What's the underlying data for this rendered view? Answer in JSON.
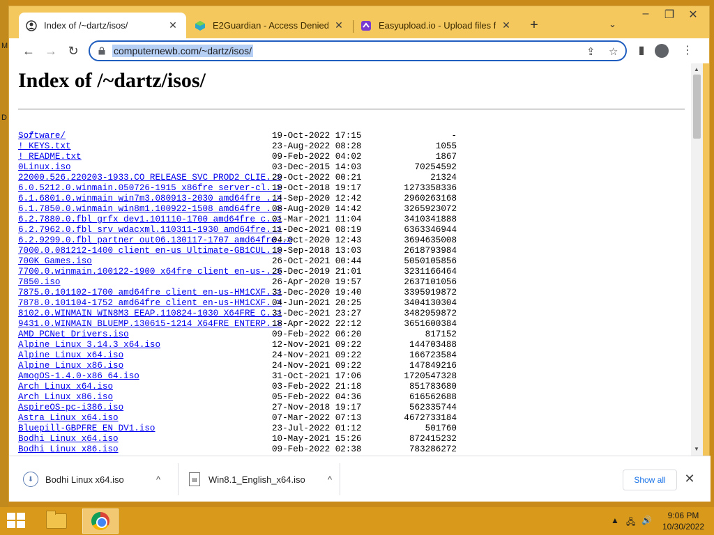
{
  "desktop": {
    "edge_letters": [
      "M",
      "D"
    ]
  },
  "browser": {
    "tabs": [
      {
        "title": "Index of /~dartz/isos/",
        "favicon": "globe-person-icon",
        "active": true
      },
      {
        "title": "E2Guardian - Access Denied",
        "favicon": "e2guardian-icon",
        "active": false
      },
      {
        "title": "Easyupload.io - Upload files for f",
        "favicon": "easyupload-icon",
        "active": false
      }
    ],
    "url": "computernewb.com/~dartz/isos/",
    "colors": {
      "tabstrip": "#f4c85d",
      "url_highlight": "#b6cff5",
      "link": "#0000ee",
      "omnibox_border": "#1f5dbf"
    }
  },
  "page": {
    "title": "Index of /~dartz/isos/",
    "parent_link": "../",
    "entries": [
      {
        "name": "Software/",
        "date": "19-Oct-2022 17:15",
        "size": "-"
      },
      {
        "name": "!_KEYS.txt",
        "date": "23-Aug-2022 08:28",
        "size": "1055"
      },
      {
        "name": "!_README.txt",
        "date": "09-Feb-2022 04:02",
        "size": "1867"
      },
      {
        "name": "0Linux.iso",
        "date": "03-Dec-2015 14:03",
        "size": "70254592"
      },
      {
        "name": "22000.526.220203-1933.CO_RELEASE_SVC_PROD2_CLIE..>",
        "date": "29-Oct-2022 00:21",
        "size": "21324"
      },
      {
        "name": "6.0.5212.0.winmain.050726-1915_x86fre_server-cl..>",
        "date": "19-Oct-2018 19:17",
        "size": "1273358336"
      },
      {
        "name": "6.1.6801.0.winmain_win7m3.080913-2030_amd64fre_..>",
        "date": "14-Sep-2020 12:42",
        "size": "2960263168"
      },
      {
        "name": "6.1.7850.0.winmain_win8m1.100922-1508_amd64fre_..>",
        "date": "08-Aug-2020 14:42",
        "size": "3265923072"
      },
      {
        "name": "6.2.7880.0.fbl_grfx_dev1.101110-1700_amd64fre_c..>",
        "date": "01-Mar-2021 11:04",
        "size": "3410341888"
      },
      {
        "name": "6.2.7962.0.fbl_srv_wdacxml.110311-1930_amd64fre..>",
        "date": "11-Dec-2021 08:19",
        "size": "6363346944"
      },
      {
        "name": "6.2.9299.0.fbl_partner_out06.130117-1707_amd64fre..>",
        "date": "04-Oct-2020 12:43",
        "size": "3694635008"
      },
      {
        "name": "7000.0.081212-1400_client_en-us_Ultimate-GB1CUL..>",
        "date": "10-Sep-2018 13:03",
        "size": "2618793984"
      },
      {
        "name": "700K_Games.iso",
        "date": "26-Oct-2021 00:44",
        "size": "5050105856"
      },
      {
        "name": "7700.0.winmain.100122-1900_x64fre_client_en-us-..>",
        "date": "26-Dec-2019 21:01",
        "size": "3231166464"
      },
      {
        "name": "7850.iso",
        "date": "26-Apr-2020 19:57",
        "size": "2637101056"
      },
      {
        "name": "7875.0.101102-1700_amd64fre_client_en-us-HM1CXF..>",
        "date": "31-Dec-2020 19:40",
        "size": "3395919872"
      },
      {
        "name": "7878.0.101104-1752_amd64fre_client_en-us-HM1CXF..>",
        "date": "04-Jun-2021 20:25",
        "size": "3404130304"
      },
      {
        "name": "8102.0.WINMAIN_WIN8M3_EEAP.110824-1030_X64FRE_C..>",
        "date": "31-Dec-2021 23:27",
        "size": "3482959872"
      },
      {
        "name": "9431.0.WINMAIN_BLUEMP.130615-1214_X64FRE_ENTERP..>",
        "date": "18-Apr-2022 22:12",
        "size": "3651600384"
      },
      {
        "name": "AMD_PCNet_Drivers.iso",
        "date": "09-Feb-2022 06:20",
        "size": "817152"
      },
      {
        "name": "Alpine_Linux_3.14.3_x64.iso",
        "date": "12-Nov-2021 09:22",
        "size": "144703488"
      },
      {
        "name": "Alpine_Linux_x64.iso",
        "date": "24-Nov-2021 09:22",
        "size": "166723584"
      },
      {
        "name": "Alpine_Linux_x86.iso",
        "date": "24-Nov-2021 09:22",
        "size": "147849216"
      },
      {
        "name": "AmogOS-1.4.0-x86_64.iso",
        "date": "31-Oct-2021 17:06",
        "size": "1720547328"
      },
      {
        "name": "Arch_Linux_x64.iso",
        "date": "03-Feb-2022 21:18",
        "size": "851783680"
      },
      {
        "name": "Arch_Linux_x86.iso",
        "date": "05-Feb-2022 04:36",
        "size": "616562688"
      },
      {
        "name": "AspireOS-pc-i386.iso",
        "date": "27-Nov-2018 19:17",
        "size": "562335744"
      },
      {
        "name": "Astra_Linux_x64.iso",
        "date": "07-Mar-2022 07:13",
        "size": "4672733184"
      },
      {
        "name": "Bluepill-GBPFRE_EN_DV1.iso",
        "date": "23-Jul-2022 01:12",
        "size": "501760"
      },
      {
        "name": "Bodhi_Linux_x64.iso",
        "date": "10-May-2021 15:26",
        "size": "872415232"
      },
      {
        "name": "Bodhi_Linux_x86.iso",
        "date": "09-Feb-2022 02:38",
        "size": "783286272"
      }
    ]
  },
  "downloads": {
    "items": [
      {
        "name": "Bodhi Linux x64.iso"
      },
      {
        "name": "Win8.1_English_x64.iso"
      }
    ],
    "show_all": "Show all"
  },
  "taskbar": {
    "time": "9:06 PM",
    "date": "10/30/2022"
  }
}
